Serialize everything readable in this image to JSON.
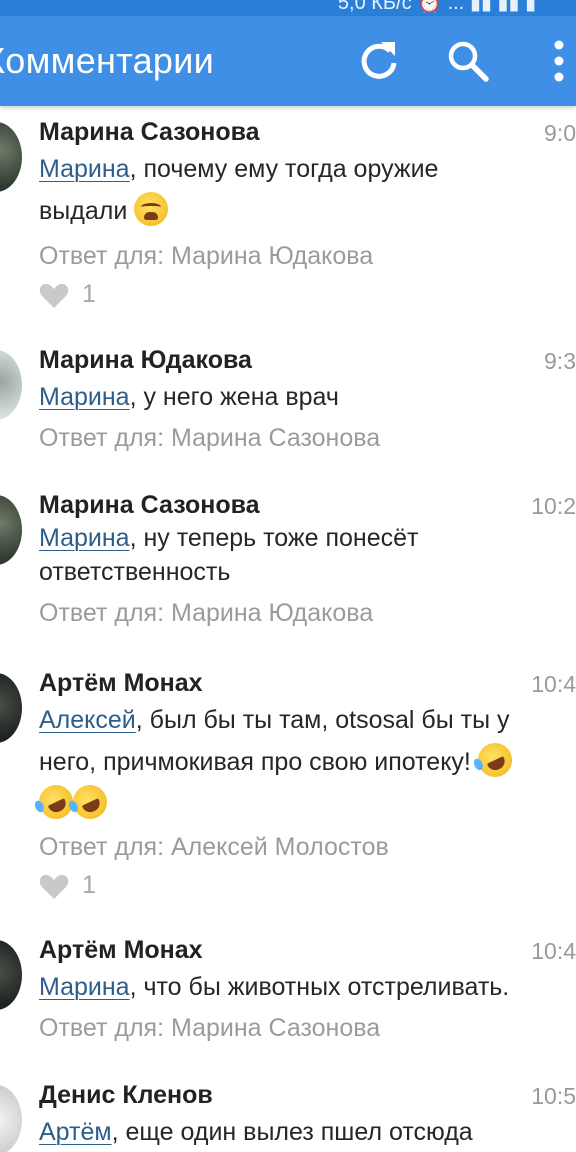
{
  "status_bar": {
    "text": "5,0 КБ/с ⏰ ... ▮▮ ▮▮ ▮"
  },
  "header": {
    "title": "Комментарии",
    "accent_color": "#3f8fe6"
  },
  "toolbar": {
    "refresh_icon": "refresh-icon",
    "search_icon": "search-icon",
    "menu_icon": "more-vertical-icon"
  },
  "comments": [
    {
      "author": "Марина Сазонова",
      "time": "9:0",
      "mention": "Марина",
      "text_line1": ", почему ему тогда оружие",
      "text_line2": "выдали",
      "emoji": "weary-face",
      "reply_to": "Ответ для: Марина Юдакова",
      "likes": "1"
    },
    {
      "author": "Марина Юдакова",
      "time": "9:3",
      "mention": "Марина",
      "text_line1": ", у него жена врач",
      "reply_to": "Ответ для: Марина Сазонова"
    },
    {
      "author": "Марина Сазонова",
      "time": "10:2",
      "mention": "Марина",
      "text_line1": ", ну теперь тоже понесёт",
      "text_line2": "ответственность",
      "reply_to": "Ответ для: Марина Юдакова"
    },
    {
      "author": "Артём Монах",
      "time": "10:4",
      "mention": "Алексей",
      "text_line1": ", был бы ты там, otsosal бы ты у",
      "text_line2": "него, причмокивая про свою ипотеку!",
      "emoji": "rofl",
      "reply_to": "Ответ для: Алексей Молостов",
      "likes": "1"
    },
    {
      "author": "Артём Монах",
      "time": "10:4",
      "mention": "Марина",
      "text_line1": ", что бы животных отстреливать.",
      "reply_to": "Ответ для: Марина Сазонова"
    },
    {
      "author": "Денис Кленов",
      "time": "10:5",
      "mention": "Артём",
      "text_line1": ", еще один вылез пшел отсюда"
    }
  ]
}
